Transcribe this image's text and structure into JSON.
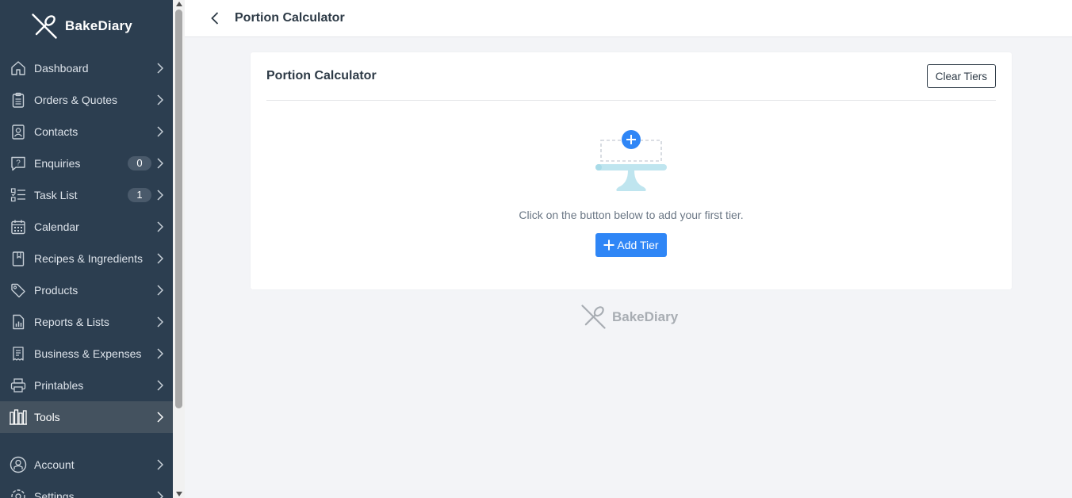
{
  "app": {
    "name": "BakeDiary"
  },
  "sidebar": {
    "items": [
      {
        "label": "Dashboard",
        "icon": "home-icon"
      },
      {
        "label": "Orders & Quotes",
        "icon": "clipboard-icon"
      },
      {
        "label": "Contacts",
        "icon": "contact-card-icon"
      },
      {
        "label": "Enquiries",
        "icon": "question-chat-icon",
        "count": "0"
      },
      {
        "label": "Task List",
        "icon": "checklist-icon",
        "count": "1"
      },
      {
        "label": "Calendar",
        "icon": "calendar-icon"
      },
      {
        "label": "Recipes & Ingredients",
        "icon": "recipe-book-icon"
      },
      {
        "label": "Products",
        "icon": "tag-icon"
      },
      {
        "label": "Reports & Lists",
        "icon": "report-icon"
      },
      {
        "label": "Business & Expenses",
        "icon": "receipt-icon"
      },
      {
        "label": "Printables",
        "icon": "printer-icon"
      },
      {
        "label": "Tools",
        "icon": "tools-icon",
        "active": true
      }
    ],
    "bottom_items": [
      {
        "label": "Account",
        "icon": "account-icon"
      },
      {
        "label": "Settings",
        "icon": "settings-icon"
      }
    ]
  },
  "topbar": {
    "title": "Portion Calculator"
  },
  "card": {
    "title": "Portion Calculator",
    "clear_button": "Clear Tiers",
    "empty_message": "Click on the button below to add your first tier.",
    "add_button": "Add Tier"
  },
  "footer": {
    "brand": "BakeDiary"
  },
  "colors": {
    "sidebar_bg": "#2c3e50",
    "sidebar_active": "#44525f",
    "primary": "#2f86f6",
    "page_bg": "#f3f4f7"
  }
}
